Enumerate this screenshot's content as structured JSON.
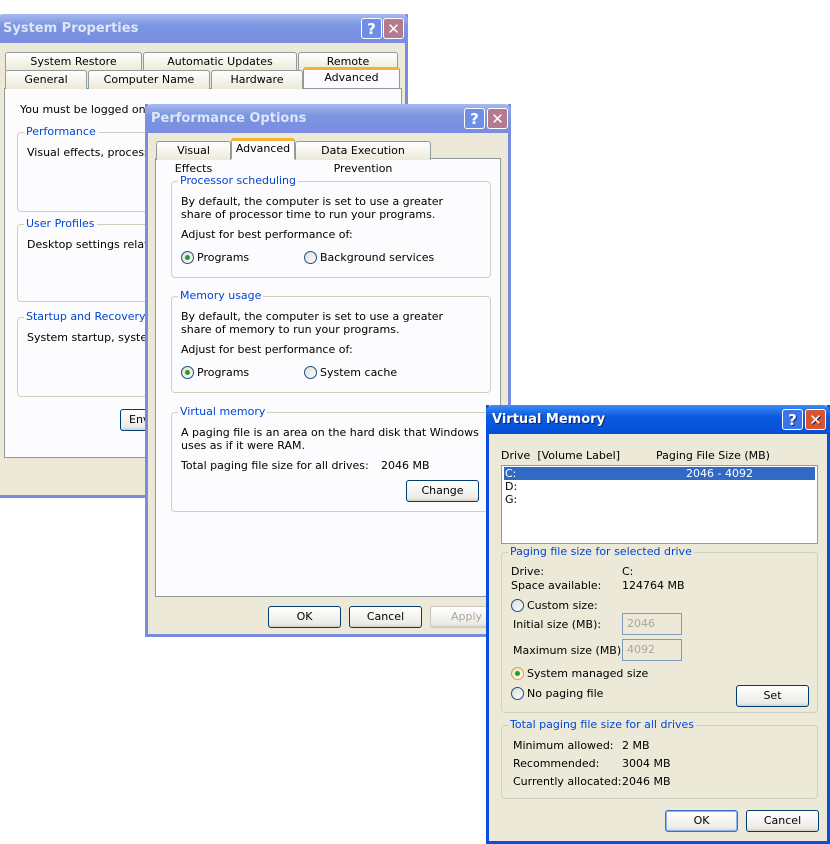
{
  "system_properties": {
    "title": "System Properties",
    "tabs_row1": [
      "System Restore",
      "Automatic Updates",
      "Remote"
    ],
    "tabs_row2": [
      "General",
      "Computer Name",
      "Hardware",
      "Advanced"
    ],
    "selected_tab": "Advanced",
    "intro": "You must be logged on as",
    "groups": [
      {
        "label": "Performance",
        "text": "Visual effects, processor s"
      },
      {
        "label": "User Profiles",
        "text": "Desktop settings related t"
      },
      {
        "label": "Startup and Recovery",
        "text": "System startup, system fa"
      }
    ],
    "env_button": "Env"
  },
  "performance_options": {
    "title": "Performance Options",
    "tabs": [
      "Visual Effects",
      "Advanced",
      "Data Execution Prevention"
    ],
    "selected_tab": "Advanced",
    "processor": {
      "label": "Processor scheduling",
      "text": "By default, the computer is set to use a greater share of processor time to run your programs.",
      "adjust": "Adjust for best performance of:",
      "options": [
        "Programs",
        "Background services"
      ],
      "selected": "Programs"
    },
    "memory": {
      "label": "Memory usage",
      "text": "By default, the computer is set to use a greater share of memory to run your programs.",
      "adjust": "Adjust for best performance of:",
      "options": [
        "Programs",
        "System cache"
      ],
      "selected": "Programs"
    },
    "virtual": {
      "label": "Virtual memory",
      "text": "A paging file is an area on the hard disk that Windows uses as if it were RAM.",
      "total_label": "Total paging file size for all drives:",
      "total_value": "2046 MB",
      "change": "Change"
    },
    "buttons": {
      "ok": "OK",
      "cancel": "Cancel",
      "apply": "Apply"
    }
  },
  "virtual_memory": {
    "title": "Virtual Memory",
    "col_drive": "Drive  [Volume Label]",
    "col_size": "Paging File Size (MB)",
    "drives": [
      {
        "drive": "C:",
        "size": "2046 - 4092",
        "selected": true
      },
      {
        "drive": "D:",
        "size": ""
      },
      {
        "drive": "G:",
        "size": ""
      }
    ],
    "selected_group": {
      "label": "Paging file size for selected drive",
      "drive_label": "Drive:",
      "drive_value": "C:",
      "space_label": "Space available:",
      "space_value": "124764 MB",
      "custom": "Custom size:",
      "initial_label": "Initial size (MB):",
      "initial_value": "2046",
      "max_label": "Maximum size (MB):",
      "max_value": "4092",
      "system_managed": "System managed size",
      "no_paging": "No paging file",
      "selected_option": "System managed size",
      "set": "Set"
    },
    "total_group": {
      "label": "Total paging file size for all drives",
      "min_label": "Minimum allowed:",
      "min_value": "2 MB",
      "rec_label": "Recommended:",
      "rec_value": "3004 MB",
      "cur_label": "Currently allocated:",
      "cur_value": "2046 MB"
    },
    "buttons": {
      "ok": "OK",
      "cancel": "Cancel"
    }
  }
}
